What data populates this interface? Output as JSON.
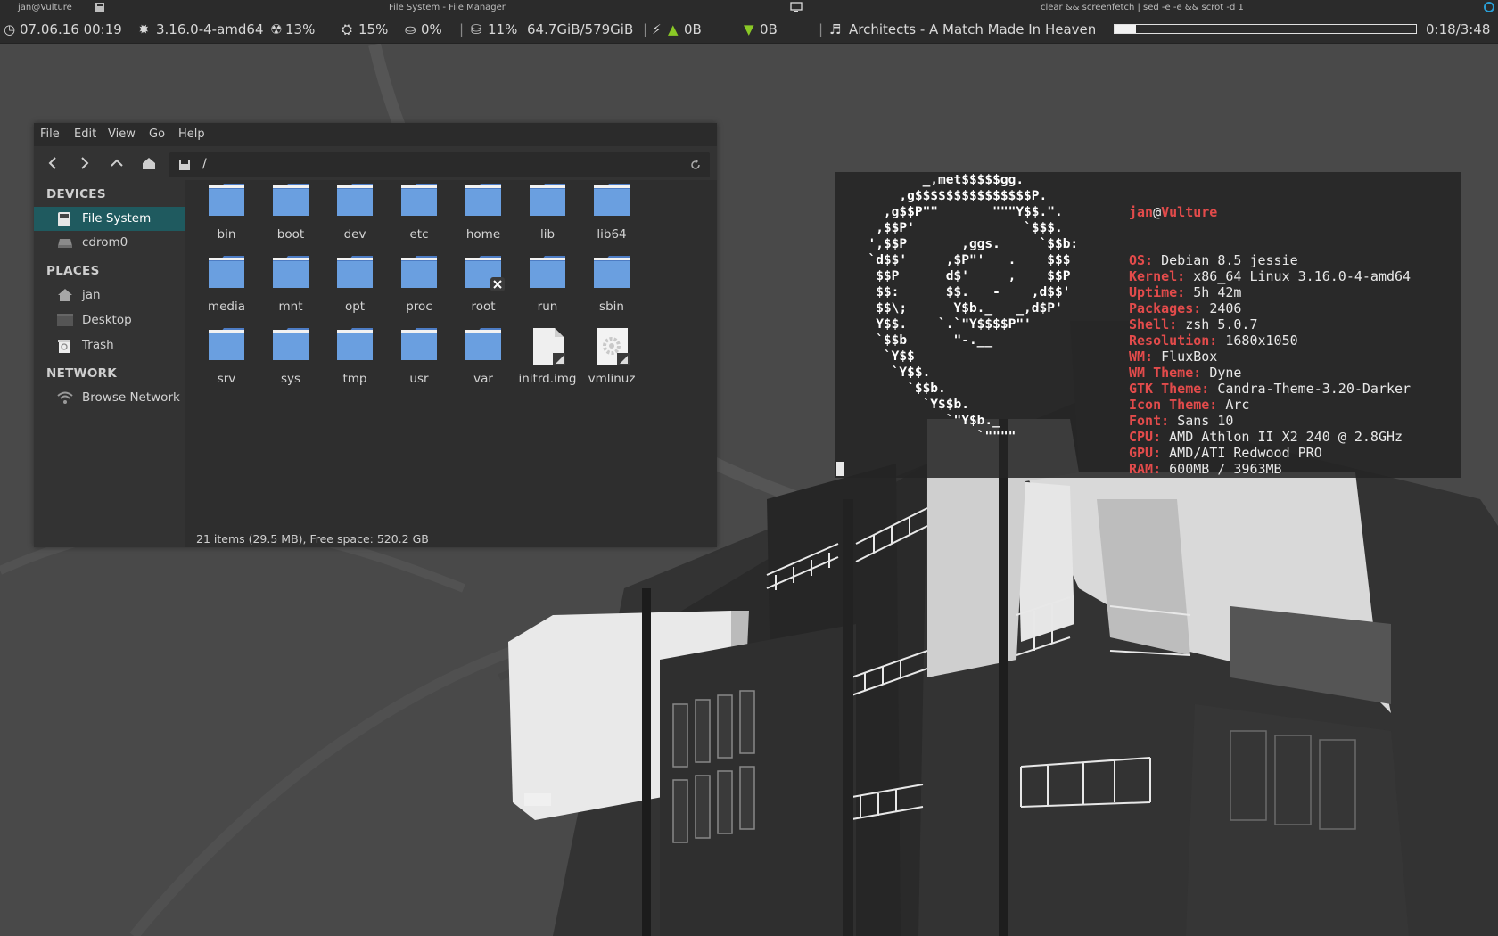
{
  "titlebar": {
    "left_title": "jan@Vulture",
    "center_title": "File System - File Manager",
    "right_title": "clear && screenfetch | sed -e  -e  && scrot -d 1"
  },
  "statusbar": {
    "datetime": "07.06.16 00:19",
    "kernel": "3.16.0-4-amd64",
    "cpu": "13%",
    "mem": "15%",
    "swap": "0%",
    "disk_pct": "11%",
    "disk_usage": "64.7GiB/579GiB",
    "net_up": "0B",
    "net_down": "0B",
    "track": "Architects - A Match Made In Heaven",
    "track_progress": 0.07,
    "track_time": "0:18/3:48"
  },
  "file_manager": {
    "menu": [
      "File",
      "Edit",
      "View",
      "Go",
      "Help"
    ],
    "path": "/",
    "sidebar": {
      "devices_title": "DEVICES",
      "devices": [
        {
          "label": "File System",
          "icon": "drive-icon"
        },
        {
          "label": "cdrom0",
          "icon": "optical-drive-icon"
        }
      ],
      "places_title": "PLACES",
      "places": [
        {
          "label": "jan",
          "icon": "home-icon"
        },
        {
          "label": "Desktop",
          "icon": "desktop-icon"
        },
        {
          "label": "Trash",
          "icon": "trash-icon"
        }
      ],
      "network_title": "NETWORK",
      "network": [
        {
          "label": "Browse Network",
          "icon": "network-icon"
        }
      ]
    },
    "files": [
      {
        "name": "bin",
        "type": "folder"
      },
      {
        "name": "boot",
        "type": "folder"
      },
      {
        "name": "dev",
        "type": "folder"
      },
      {
        "name": "etc",
        "type": "folder"
      },
      {
        "name": "home",
        "type": "folder"
      },
      {
        "name": "lib",
        "type": "folder"
      },
      {
        "name": "lib64",
        "type": "folder"
      },
      {
        "name": "media",
        "type": "folder"
      },
      {
        "name": "mnt",
        "type": "folder"
      },
      {
        "name": "opt",
        "type": "folder"
      },
      {
        "name": "proc",
        "type": "folder"
      },
      {
        "name": "root",
        "type": "folder-locked"
      },
      {
        "name": "run",
        "type": "folder"
      },
      {
        "name": "sbin",
        "type": "folder"
      },
      {
        "name": "srv",
        "type": "folder"
      },
      {
        "name": "sys",
        "type": "folder"
      },
      {
        "name": "tmp",
        "type": "folder"
      },
      {
        "name": "usr",
        "type": "folder"
      },
      {
        "name": "var",
        "type": "folder"
      },
      {
        "name": "initrd.img",
        "type": "file-link"
      },
      {
        "name": "vmlinuz",
        "type": "exec-link"
      }
    ],
    "status": "21 items (29.5 MB), Free space: 520.2 GB"
  },
  "terminal": {
    "logo_lines": [
      "         _,met$$$$$gg.",
      "      ,g$$$$$$$$$$$$$$$P.",
      "    ,g$$P\"\"       \"\"\"Y$$.\".",
      "   ,$$P'              `$$$.",
      "  ',$$P       ,ggs.     `$$b:",
      "  `d$$'     ,$P\"'   .    $$$",
      "   $$P      d$'     ,    $$P",
      "   $$:      $$.   -    ,d$$'",
      "   $$\\;      Y$b._   _,d$P'",
      "   Y$$.    `.`\"Y$$$$P\"'",
      "   `$$b      \"-.__",
      "    `Y$$",
      "     `Y$$.",
      "       `$$b.",
      "         `Y$$b.",
      "            `\"Y$b._",
      "                `\"\"\"\""
    ],
    "user": "jan",
    "at": "@",
    "host": "Vulture",
    "info": [
      {
        "key": "OS:",
        "value": "Debian 8.5 jessie"
      },
      {
        "key": "Kernel:",
        "value": "x86_64 Linux 3.16.0-4-amd64"
      },
      {
        "key": "Uptime:",
        "value": "5h 42m"
      },
      {
        "key": "Packages:",
        "value": "2406"
      },
      {
        "key": "Shell:",
        "value": "zsh 5.0.7"
      },
      {
        "key": "Resolution:",
        "value": "1680x1050"
      },
      {
        "key": "WM:",
        "value": "FluxBox"
      },
      {
        "key": "WM Theme:",
        "value": "Dyne"
      },
      {
        "key": "GTK Theme:",
        "value": "Candra-Theme-3.20-Darker"
      },
      {
        "key": "Icon Theme:",
        "value": "Arc"
      },
      {
        "key": "Font:",
        "value": "Sans 10"
      },
      {
        "key": "CPU:",
        "value": "AMD Athlon II X2 240 @ 2.8GHz"
      },
      {
        "key": "GPU:",
        "value": "AMD/ATI Redwood PRO"
      },
      {
        "key": "RAM:",
        "value": "600MB / 3963MB"
      }
    ]
  },
  "colors": {
    "accent_red": "#e24b4b",
    "sidebar_selected": "#1f5a5f",
    "folder_blue": "#6a9fe0",
    "net_arrow_green": "#8ac926"
  }
}
